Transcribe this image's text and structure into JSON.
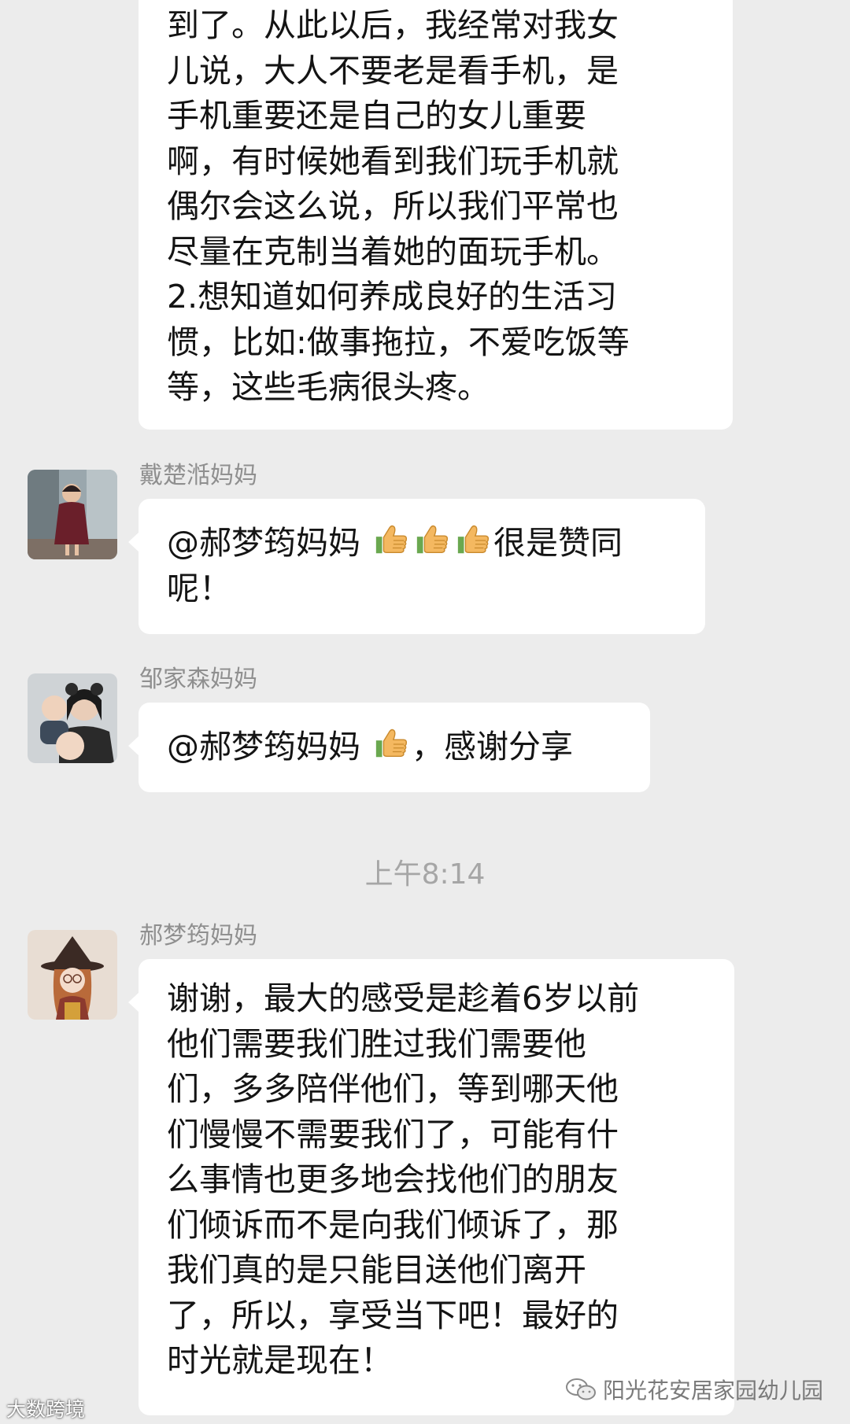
{
  "messages": [
    {
      "lines": [
        "到了。从此以后，我经常对我女",
        "儿说，大人不要老是看手机，是",
        "手机重要还是自己的女儿重要",
        "啊，有时候她看到我们玩手机就",
        "偶尔会这么说，所以我们平常也",
        "尽量在克制当着她的面玩手机。",
        "2.想知道如何养成良好的生活习",
        "惯，比如:做事拖拉，不爱吃饭等",
        "等，这些毛病很头疼。"
      ]
    },
    {
      "sender": "戴楚湉妈妈",
      "mention": "@郝梦筠妈妈",
      "after_emoji": "很是赞同",
      "line2": "呢！"
    },
    {
      "sender": "邹家森妈妈",
      "mention": "@郝梦筠妈妈",
      "after_emoji": "，感谢分享"
    },
    {
      "sender": "郝梦筠妈妈",
      "lines": [
        "谢谢，最大的感受是趁着6岁以前",
        "他们需要我们胜过我们需要他",
        "们，多多陪伴他们，等到哪天他",
        "们慢慢不需要我们了，可能有什",
        "么事情也更多地会找他们的朋友",
        "们倾诉而不是向我们倾诉了，那",
        "我们真的是只能目送他们离开",
        "了，所以，享受当下吧！最好的",
        "时光就是现在！"
      ]
    }
  ],
  "timestamp": "上午8:14",
  "watermark_left": "大数跨境",
  "watermark_right": "阳光花安居家园幼儿园",
  "colors": {
    "background": "#ececec",
    "bubble": "#ffffff",
    "text": "#141414",
    "sender": "#8f8f8f",
    "timestamp": "#a6a6a6"
  }
}
